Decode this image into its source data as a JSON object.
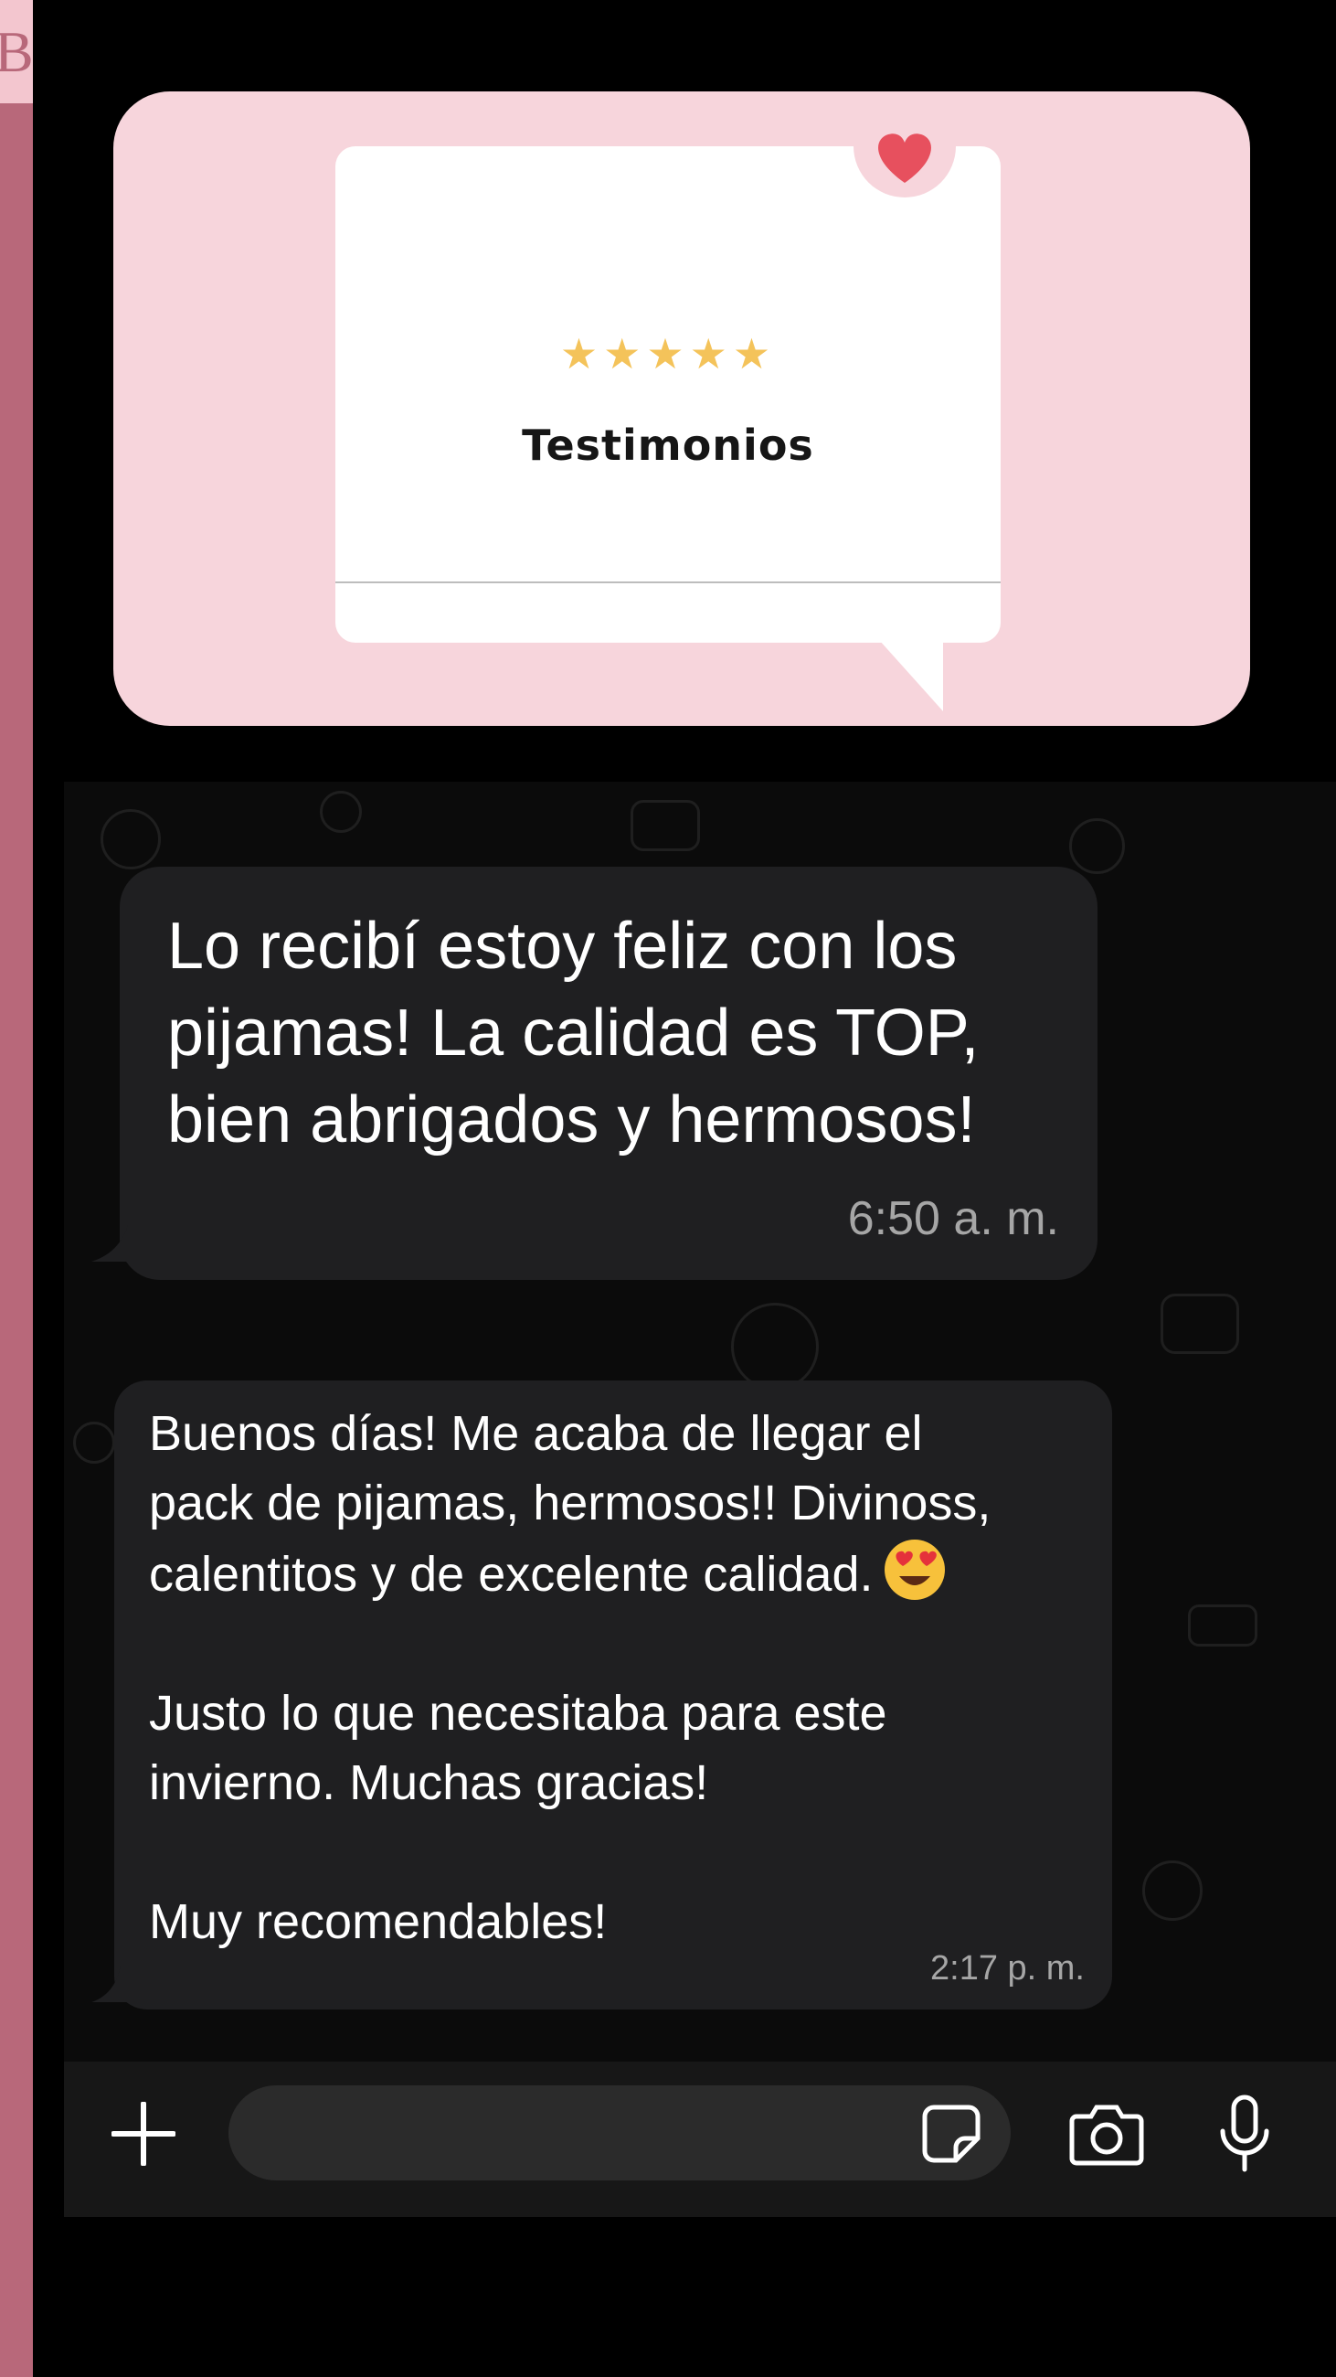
{
  "sidebar_tab_letter": "B",
  "promo_card": {
    "rating_stars": "★★★★★",
    "title": "Testimonios",
    "colors": {
      "card_bg": "#f7d5dc",
      "heart": "#e7505e",
      "stars": "#f4c35a"
    }
  },
  "messages": [
    {
      "text": "Lo recibí estoy feliz con los pijamas! La calidad es TOP, bien abrigados y hermosos!",
      "time": "6:50 a. m."
    },
    {
      "text": "Buenos días! Me acaba de llegar el\npack de pijamas, hermosos!! Divinoss,\ncalentitos y de excelente calidad.",
      "emoji": "heart-eyes-emoji",
      "text_after": "\n\nJusto lo que necesitaba para este\ninvierno. Muchas gracias!\n\nMuy recomendables!",
      "time": "2:17 p. m."
    }
  ],
  "composer": {
    "icons": [
      "plus-icon",
      "sticker-icon",
      "camera-icon",
      "microphone-icon"
    ],
    "input_value": ""
  }
}
